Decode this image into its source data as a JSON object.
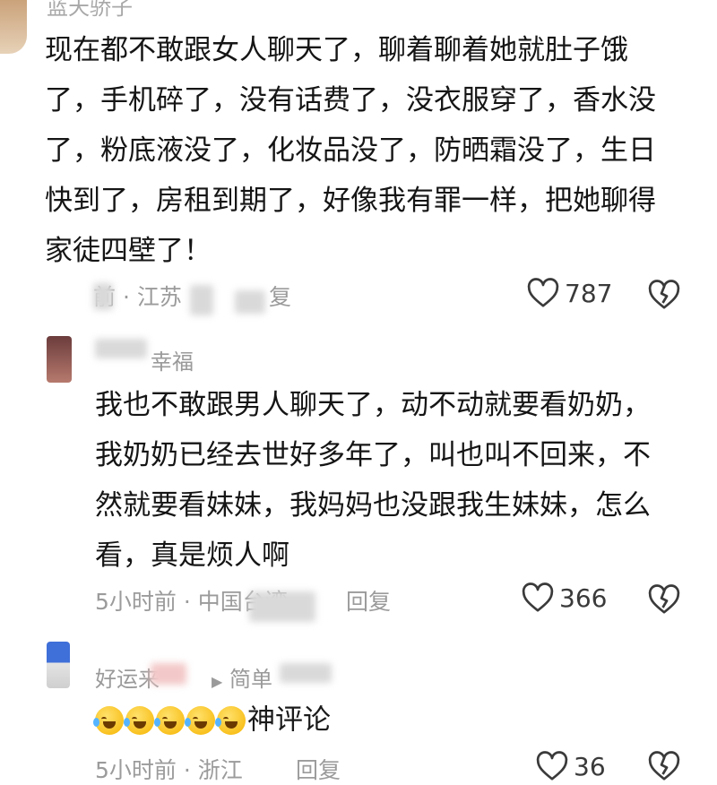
{
  "comments": [
    {
      "username": "蓝天骄子",
      "text": "现在都不敢跟女人聊天了，聊着聊着她就肚子饿了，手机碎了，没有话费了，没衣服穿了，香水没了，粉底液没了，化妆品没了，防晒霜没了，生日快到了，房租到期了，好像我有罪一样，把她聊得家徒四壁了！",
      "time": "前",
      "location": "· 江苏",
      "reply_label": "复",
      "likes": "787"
    },
    {
      "username": "幸福",
      "text": "我也不敢跟男人聊天了，动不动就要看奶奶，我奶奶已经去世好多年了，叫也叫不回来，不然就要看妹妹，我妈妈也没跟我生妹妹，怎么看，真是烦人啊",
      "time": "5小时前",
      "location": "· 中国台湾",
      "reply_label": "回复",
      "likes": "366"
    },
    {
      "username": "好运来",
      "reply_to": "简单",
      "text": "神评论",
      "time": "5小时前",
      "location": "· 浙江",
      "reply_label": "回复",
      "likes": "36"
    }
  ],
  "colors": {
    "text": "#151515",
    "meta": "#9b9b9b"
  }
}
